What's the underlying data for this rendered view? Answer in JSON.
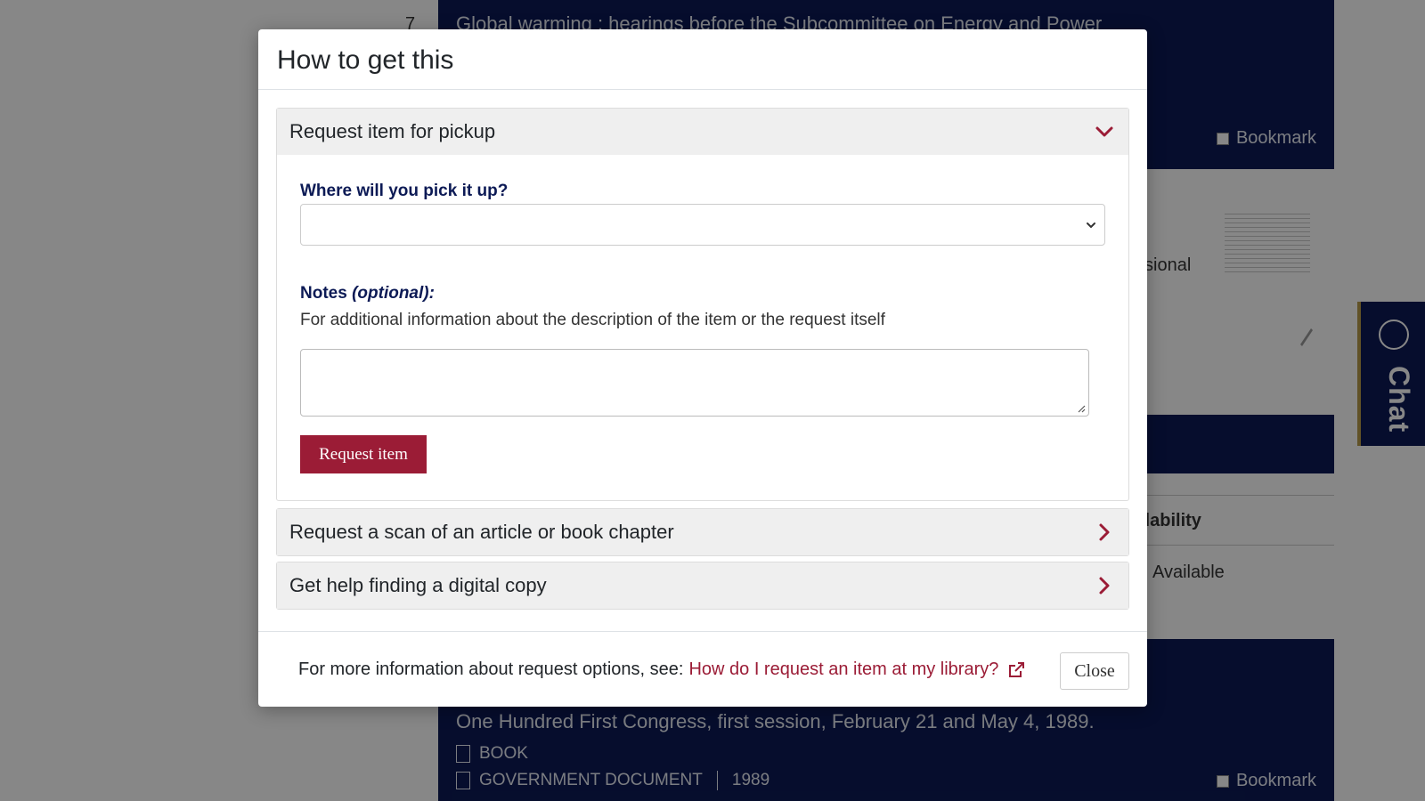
{
  "background": {
    "result_number": "7",
    "card1": {
      "title": "Global warming : hearings before the Subcommittee on Energy and Power",
      "bookmark_label": "Bookmark"
    },
    "card2": {
      "partial_text": "ssional"
    },
    "card3": {
      "availability_header": "ilability",
      "availability_value": "Available"
    },
    "card4": {
      "partial_title": "r",
      "subtitle": "One Hundred First Congress, first session, February 21 and May 4, 1989.",
      "format1": "BOOK",
      "format2": "GOVERNMENT DOCUMENT",
      "year": "1989",
      "bookmark_label": "Bookmark"
    },
    "chat_label": "Chat"
  },
  "modal": {
    "title": "How to get this",
    "sections": [
      {
        "label": "Request item for pickup",
        "expanded": true,
        "pickup_label": "Where will you pick it up?",
        "pickup_value": "",
        "notes_label": "Notes",
        "notes_optional": "(optional):",
        "notes_help": "For additional information about the description of the item or the request itself",
        "notes_value": "",
        "submit_label": "Request item"
      },
      {
        "label": "Request a scan of an article or book chapter",
        "expanded": false
      },
      {
        "label": "Get help finding a digital copy",
        "expanded": false
      }
    ],
    "footer": {
      "text": "For more information about request options, see:",
      "link": "How do I request an item at my library?",
      "close_label": "Close"
    }
  },
  "colors": {
    "brand_navy": "#0c1a55",
    "accent_red": "#9b1c36",
    "gold": "#b89b4b"
  }
}
